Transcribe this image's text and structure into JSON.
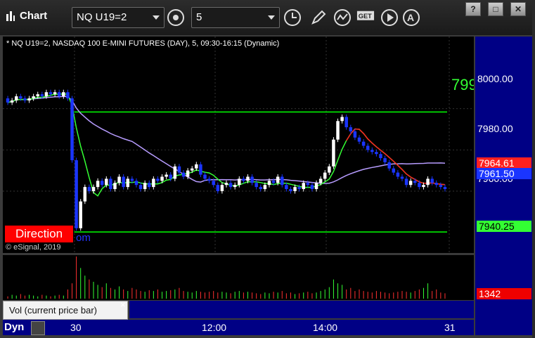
{
  "toolbar": {
    "app_title": "Chart",
    "symbol": "NQ U19=2",
    "interval": "5",
    "win_buttons": [
      "?",
      "□",
      "✕"
    ]
  },
  "chart": {
    "subtitle": "* NQ U19=2, NASDAQ 100 E-MINI FUTURES (DAY), 5, 09:30-16:15 (Dynamic)",
    "watermark": "© eSignal, 2019",
    "direction_label": "Direction",
    "obscured_label": "om",
    "level_partial_label": "799",
    "dyn_label": "Dyn",
    "volume_legend": "Vol (current price bar)",
    "volume_close": "×"
  },
  "colors": {
    "up": "#ffffff",
    "down": "#1a35ff",
    "level_line": "#00ff00",
    "ma_fast": "#33ff33",
    "ma_red": "#ff2020",
    "ma_purple": "#b79cff",
    "axis_bg": "#000085"
  },
  "chart_data": {
    "type": "candlestick",
    "price_ticks": [
      "8000.00",
      "7980.00",
      "7960.00"
    ],
    "time_ticks": [
      "30",
      "12:00",
      "14:00",
      "31"
    ],
    "price_tags": [
      {
        "label": "7964.61",
        "color": "#ff2020"
      },
      {
        "label": "7961.50",
        "color": "#1a35ff"
      },
      {
        "label": "7940.25",
        "color": "#33ff33"
      }
    ],
    "volume_tag": "1342",
    "levels": [
      7998.4,
      7940.2
    ],
    "ylim": [
      7930,
      8035
    ],
    "opens": [
      8005,
      8003,
      8004,
      8006,
      8005,
      8004,
      8005,
      8006,
      8007,
      8006,
      8008,
      8007,
      8008,
      8006,
      8008,
      8005,
      7975,
      7942,
      7955,
      7962,
      7960,
      7962,
      7965,
      7963,
      7966,
      7961,
      7964,
      7967,
      7962,
      7966,
      7965,
      7963,
      7961,
      7964,
      7962,
      7966,
      7965,
      7967,
      7968,
      7966,
      7972,
      7969,
      7967,
      7970,
      7971,
      7973,
      7968,
      7966,
      7965,
      7963,
      7960,
      7963,
      7964,
      7962,
      7963,
      7966,
      7965,
      7967,
      7964,
      7962,
      7961,
      7963,
      7965,
      7964,
      7967,
      7963,
      7961,
      7960,
      7962,
      7961,
      7964,
      7963,
      7961,
      7964,
      7966,
      7969,
      7972,
      7985,
      7994,
      7996,
      7991,
      7989,
      7986,
      7984,
      7982,
      7980,
      7979,
      7978,
      7976,
      7974,
      7971,
      7969,
      7967,
      7966,
      7963,
      7965,
      7964,
      7962,
      7963,
      7966,
      7964,
      7963,
      7962
    ],
    "closes": [
      8003,
      8004,
      8006,
      8005,
      8004,
      8005,
      8006,
      8007,
      8006,
      8008,
      8007,
      8008,
      8006,
      8008,
      8005,
      7975,
      7942,
      7955,
      7962,
      7960,
      7962,
      7965,
      7963,
      7966,
      7961,
      7964,
      7967,
      7962,
      7966,
      7965,
      7963,
      7961,
      7964,
      7962,
      7966,
      7965,
      7967,
      7968,
      7966,
      7972,
      7969,
      7967,
      7970,
      7971,
      7973,
      7968,
      7966,
      7965,
      7963,
      7960,
      7963,
      7964,
      7962,
      7963,
      7966,
      7965,
      7967,
      7964,
      7962,
      7961,
      7963,
      7965,
      7964,
      7967,
      7963,
      7961,
      7960,
      7962,
      7961,
      7964,
      7963,
      7961,
      7964,
      7966,
      7969,
      7972,
      7985,
      7994,
      7996,
      7991,
      7989,
      7986,
      7984,
      7982,
      7980,
      7979,
      7978,
      7976,
      7974,
      7971,
      7969,
      7967,
      7966,
      7963,
      7965,
      7964,
      7962,
      7963,
      7966,
      7964,
      7963,
      7962,
      7961
    ],
    "volumes": [
      3,
      5,
      4,
      6,
      4,
      5,
      4,
      3,
      5,
      4,
      3,
      4,
      5,
      4,
      12,
      20,
      55,
      40,
      30,
      25,
      22,
      18,
      15,
      20,
      14,
      12,
      16,
      12,
      10,
      14,
      12,
      10,
      9,
      11,
      10,
      12,
      9,
      10,
      11,
      12,
      14,
      10,
      9,
      8,
      10,
      9,
      8,
      9,
      10,
      8,
      9,
      8,
      7,
      9,
      10,
      8,
      9,
      8,
      7,
      6,
      8,
      7,
      9,
      8,
      10,
      7,
      8,
      6,
      7,
      8,
      9,
      7,
      8,
      10,
      12,
      15,
      25,
      20,
      18,
      12,
      14,
      10,
      12,
      10,
      9,
      8,
      10,
      9,
      8,
      7,
      8,
      9,
      10,
      9,
      8,
      10,
      12,
      14,
      20,
      10,
      12,
      8,
      7
    ]
  }
}
